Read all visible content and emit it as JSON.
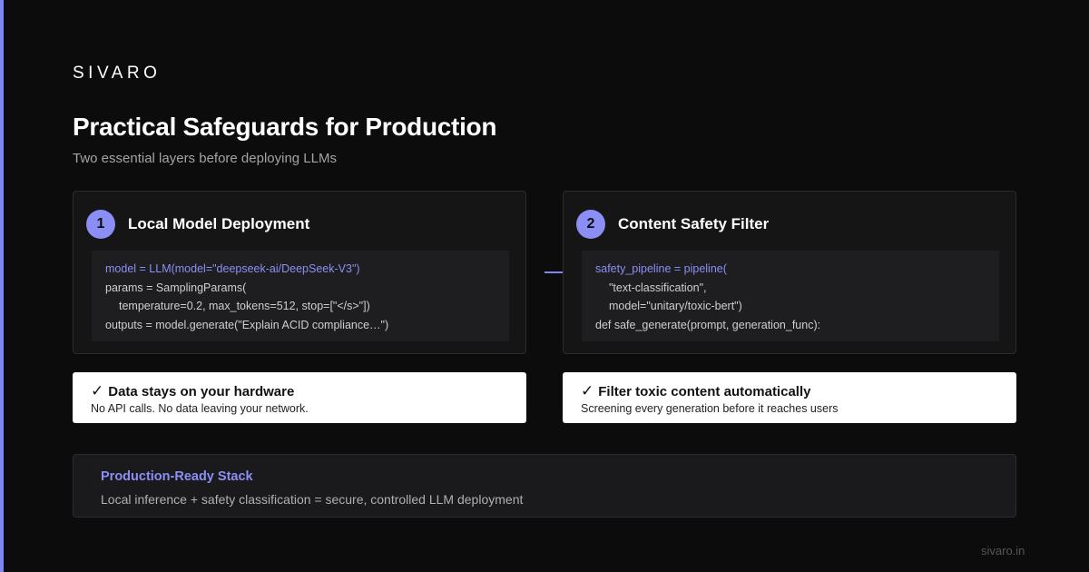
{
  "brand": "SIVARO",
  "title": "Practical Safeguards for Production",
  "subtitle": "Two essential layers before deploying LLMs",
  "cards": [
    {
      "number": "1",
      "title": "Local Model Deployment",
      "code": [
        "model = LLM(model=\"deepseek-ai/DeepSeek-V3\")",
        "params = SamplingParams(",
        "temperature=0.2, max_tokens=512, stop=[\"</s>\"])",
        "outputs = model.generate(\"Explain ACID compliance…\")"
      ]
    },
    {
      "number": "2",
      "title": "Content Safety Filter",
      "code": [
        "safety_pipeline = pipeline(",
        "\"text-classification\",",
        "model=\"unitary/toxic-bert\")",
        "def safe_generate(prompt, generation_func):"
      ]
    }
  ],
  "benefits": [
    {
      "check": "✓",
      "heading": "Data stays on your hardware",
      "description": "No API calls. No data leaving your network."
    },
    {
      "check": "✓",
      "heading": "Filter toxic content automatically",
      "description": "Screening every generation before it reaches users"
    }
  ],
  "stack": {
    "title": "Production-Ready Stack",
    "description": "Local inference + safety classification = secure, controlled LLM deployment"
  },
  "footer_url": "sivaro.in",
  "colors": {
    "background": "#0c0c0d",
    "accent": "#8b8ff5",
    "card": "#151516",
    "code_bg": "#1e1e20"
  }
}
